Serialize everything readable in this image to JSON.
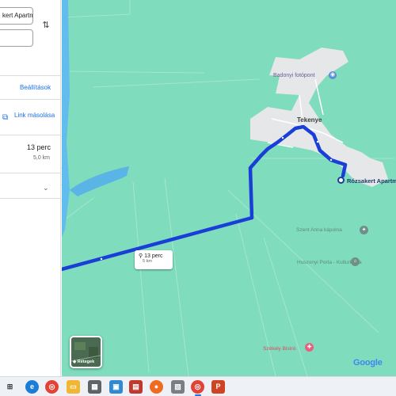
{
  "panel": {
    "origin_value": "kert Apartma",
    "destination_value": "",
    "settings_label": "Beállítások",
    "link_label": "Link másolása",
    "route_time": "13 perc",
    "route_distance": "5,0 km"
  },
  "map": {
    "poi_badonyi": "Badonyi fotópont",
    "town_tekenye": "Tekenye",
    "destination_label": "Rózsakert Apartma",
    "poi_szentanna": "Szent Anna kápolna",
    "poi_huszonyi": "Huszonyi Porta - Kulturbarta",
    "poi_szekely": "Székely Bistró",
    "google": "Google",
    "route_tip_time": "13 perc",
    "route_tip_dist": "5 km",
    "layers_label": "Rétegek"
  },
  "colors": {
    "map_bg": "#7fdcbc",
    "route": "#1a3fd8",
    "link": "#1a73e8",
    "town_area": "#e8e8e8"
  },
  "icons": {
    "swap": "swap-vertical-icon",
    "link": "link-icon",
    "chevron": "chevron-down-icon",
    "bike": "bicycle-icon",
    "layers": "layers-icon"
  },
  "taskbar": {
    "apps": [
      "task-view",
      "edge",
      "chrome",
      "file-explorer",
      "calendar",
      "image-viewer",
      "pdf-reader",
      "firefox",
      "photos",
      "chrome-active",
      "powerpoint"
    ]
  }
}
